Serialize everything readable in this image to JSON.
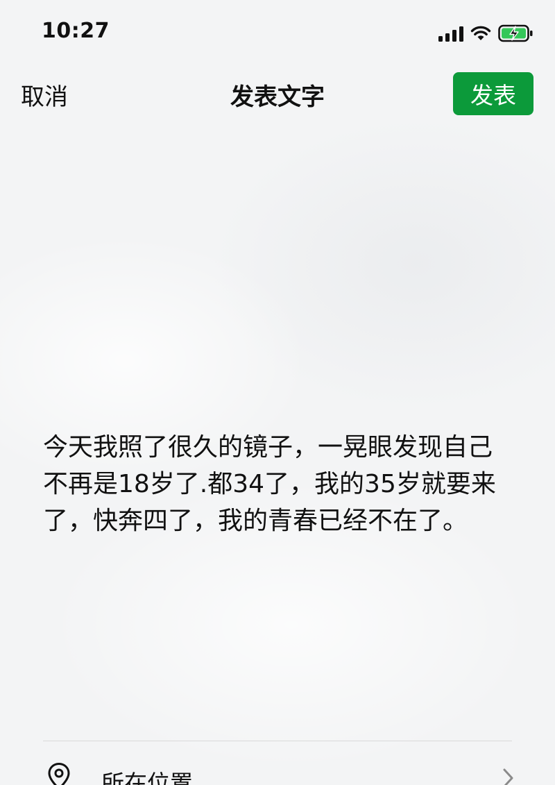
{
  "status_bar": {
    "time": "10:27",
    "icons": [
      "signal-icon",
      "wifi-icon",
      "battery-charging-icon"
    ],
    "battery_color": "#34c759"
  },
  "nav": {
    "cancel_label": "取消",
    "title": "发表文字",
    "post_label": "发表",
    "post_button_color": "#0c9a3a"
  },
  "post": {
    "text": "今天我照了很久的镜子，一晃眼发现自己不再是18岁了.都34了，我的35岁就要来了，快奔四了，我的青春已经不在了。"
  },
  "location": {
    "icon": "location-pin-icon",
    "label": "所在位置",
    "chevron": "chevron-right-icon"
  }
}
